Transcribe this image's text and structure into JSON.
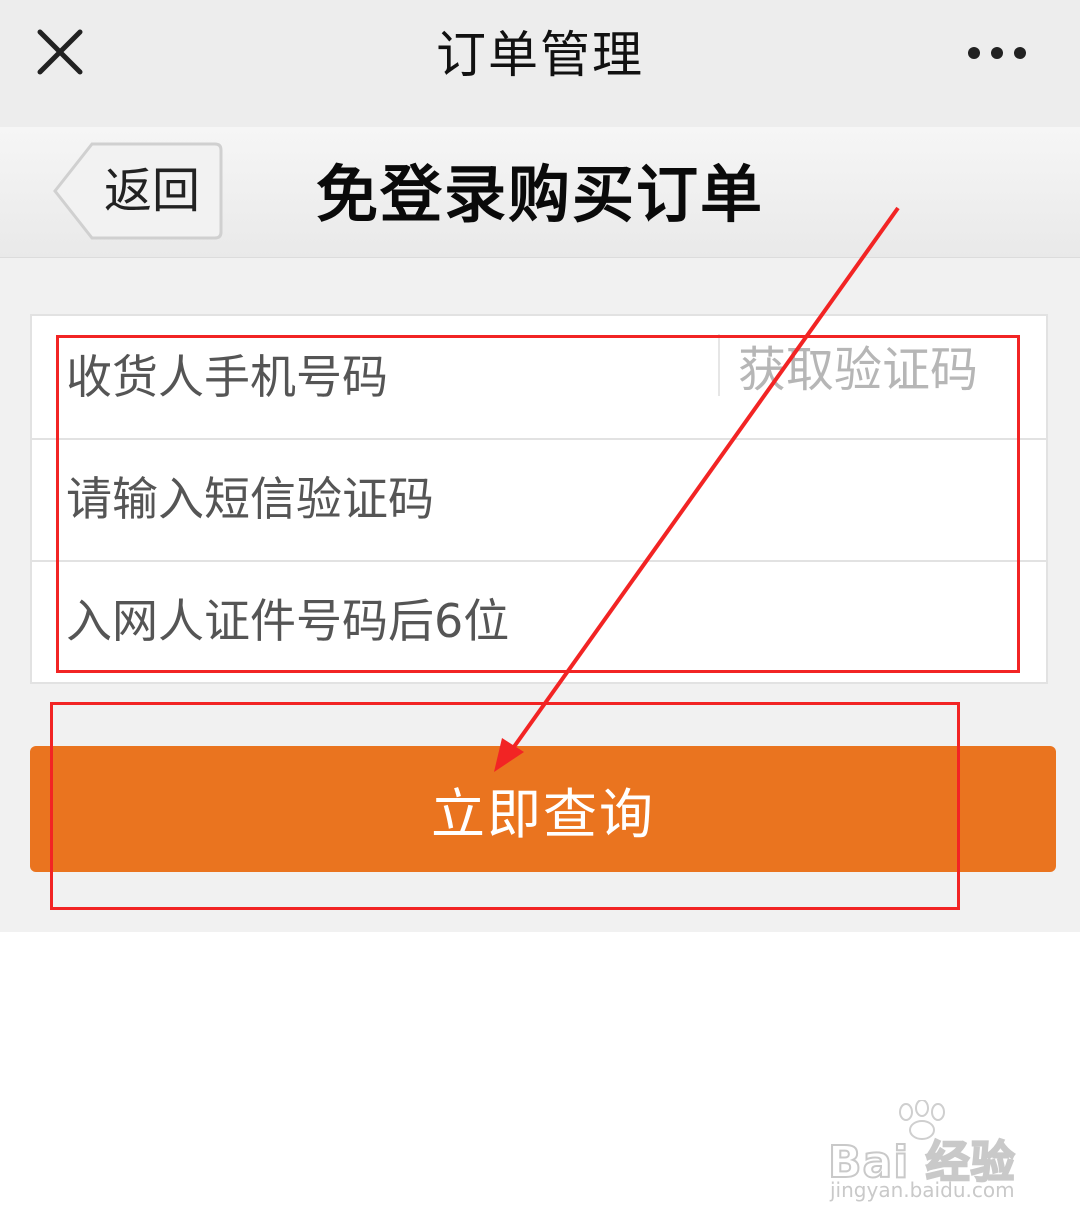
{
  "titlebar": {
    "title": "订单管理",
    "close_icon": "close-icon",
    "more_icon": "more-dots-icon"
  },
  "navbar": {
    "back_label": "返回",
    "page_title": "免登录购买订单"
  },
  "form": {
    "phone_placeholder": "收货人手机号码",
    "get_code_label": "获取验证码",
    "sms_placeholder": "请输入短信验证码",
    "id_placeholder": "入网人证件号码后6位"
  },
  "query_button_label": "立即查询",
  "colors": {
    "accent": "#ea741f",
    "annotation": "#f22424"
  },
  "watermark": {
    "logo": "Bai 经验",
    "url": "jingyan.baidu.com"
  }
}
